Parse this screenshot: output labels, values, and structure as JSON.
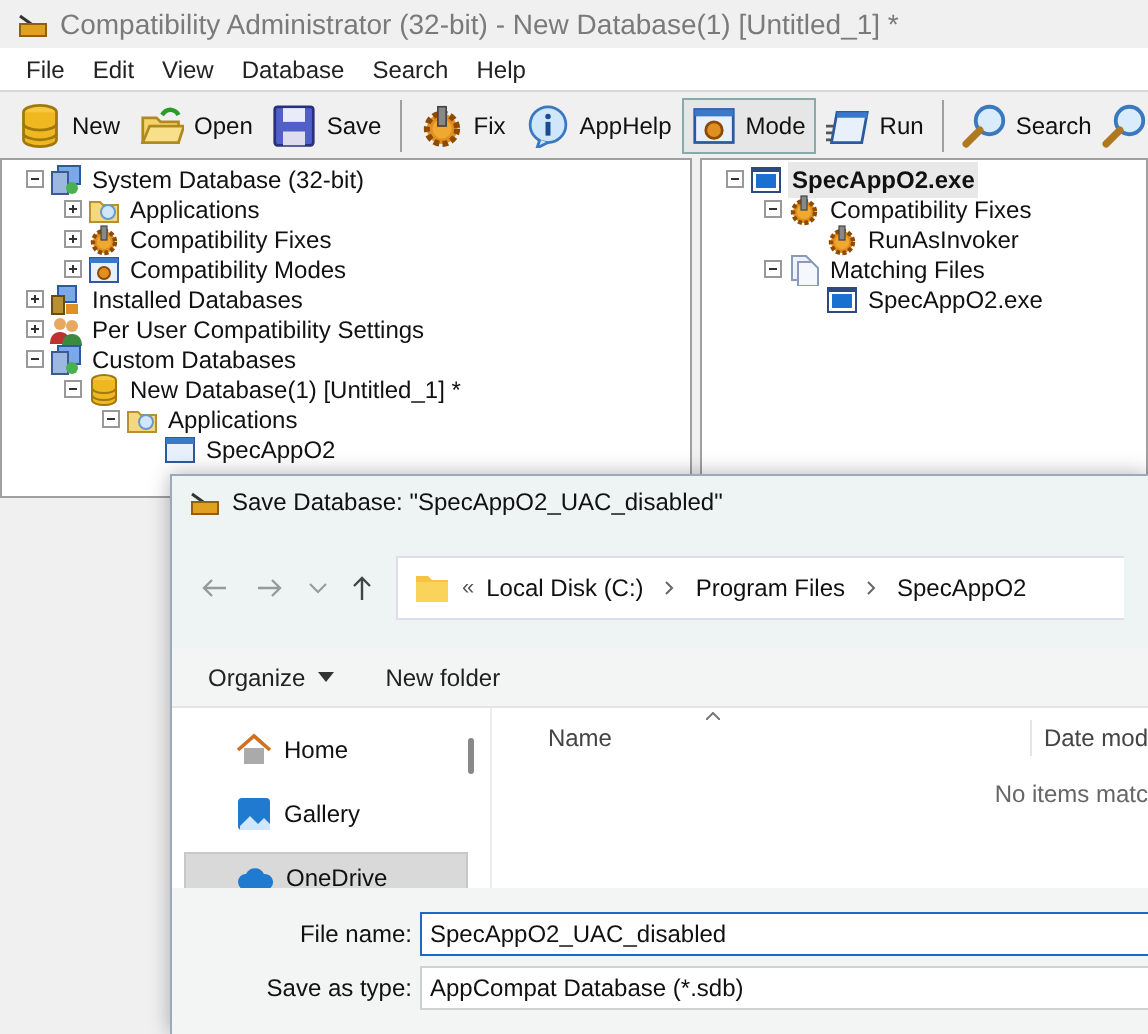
{
  "window": {
    "title": "Compatibility Administrator (32-bit) - New Database(1) [Untitled_1] *"
  },
  "menu": [
    "File",
    "Edit",
    "View",
    "Database",
    "Search",
    "Help"
  ],
  "toolbar": [
    {
      "label": "New",
      "kind": "database"
    },
    {
      "label": "Open",
      "kind": "open"
    },
    {
      "label": "Save",
      "kind": "save"
    },
    {
      "kind": "separator"
    },
    {
      "label": "Fix",
      "kind": "gear"
    },
    {
      "label": "AppHelp",
      "kind": "info"
    },
    {
      "label": "Mode",
      "kind": "mode",
      "selected": true
    },
    {
      "label": "Run",
      "kind": "run"
    },
    {
      "kind": "separator"
    },
    {
      "label": "Search",
      "kind": "search"
    },
    {
      "kind": "search"
    }
  ],
  "left_tree": [
    {
      "label": "System Database (32-bit)",
      "kind": "system",
      "expanded": true,
      "children": [
        {
          "label": "Applications",
          "kind": "apps",
          "expanded": false
        },
        {
          "label": "Compatibility Fixes",
          "kind": "gear",
          "expanded": false
        },
        {
          "label": "Compatibility Modes",
          "kind": "mode",
          "expanded": false
        }
      ]
    },
    {
      "label": "Installed Databases",
      "kind": "installed",
      "expanded": false
    },
    {
      "label": "Per User Compatibility Settings",
      "kind": "users",
      "expanded": false
    },
    {
      "label": "Custom Databases",
      "kind": "system",
      "expanded": true,
      "children": [
        {
          "label": "New Database(1) [Untitled_1] *",
          "kind": "database",
          "expanded": true,
          "children": [
            {
              "label": "Applications",
              "kind": "apps",
              "expanded": true,
              "children": [
                {
                  "label": "SpecAppO2",
                  "kind": "program"
                }
              ]
            }
          ]
        }
      ]
    }
  ],
  "right_tree": [
    {
      "label": "SpecAppO2.exe",
      "kind": "exe",
      "expanded": true,
      "selected": true,
      "children": [
        {
          "label": "Compatibility Fixes",
          "kind": "gear",
          "expanded": true,
          "selected": false,
          "children": [
            {
              "label": "RunAsInvoker",
              "kind": "gear",
              "selected": false
            }
          ]
        },
        {
          "label": "Matching Files",
          "kind": "files",
          "expanded": true,
          "selected": false,
          "children": [
            {
              "label": "SpecAppO2.exe",
              "kind": "exe",
              "selected": false
            }
          ]
        }
      ]
    }
  ],
  "dialog": {
    "title": "Save Database: \"SpecAppO2_UAC_disabled\"",
    "address": {
      "overflow": "«",
      "path": [
        "Local Disk (C:)",
        "Program Files",
        "SpecAppO2"
      ]
    },
    "commands": [
      {
        "label": "Organize",
        "kind": "dropdown"
      },
      {
        "label": "New folder",
        "kind": "plain"
      }
    ],
    "nav": [
      {
        "label": "Home",
        "kind": "home",
        "selected": false
      },
      {
        "label": "Gallery",
        "kind": "gallery",
        "selected": false
      },
      {
        "label": "OneDrive",
        "kind": "cloud",
        "selected": true
      }
    ],
    "columns": [
      "Name",
      "Date mod"
    ],
    "empty_message": "No items matc",
    "file_name": {
      "label": "File name:",
      "value": "SpecAppO2_UAC_disabled"
    },
    "save_as_type": {
      "label": "Save as type:",
      "value": "AppCompat Database (*.sdb)"
    }
  }
}
